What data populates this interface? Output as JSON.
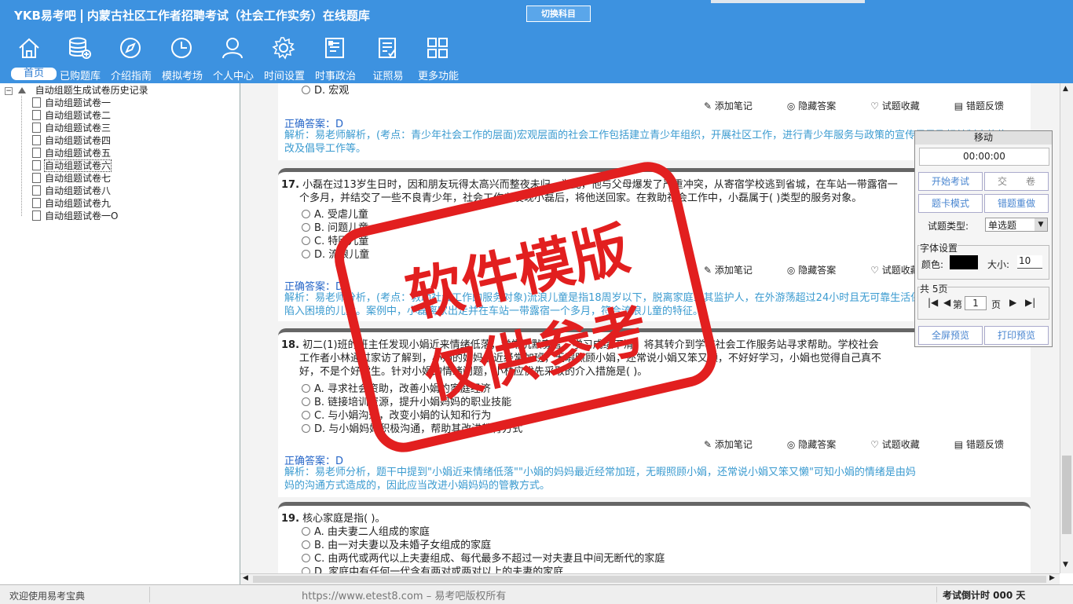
{
  "header": {
    "brand": "YKB易考吧",
    "title": "内蒙古社区工作者招聘考试（社会工作实务）在线题库",
    "switch_label": "切换科目",
    "nav": [
      {
        "label": "首页",
        "icon": "home-icon"
      },
      {
        "label": "已购题库",
        "icon": "database-icon"
      },
      {
        "label": "介绍指南",
        "icon": "compass-icon"
      },
      {
        "label": "模拟考场",
        "icon": "clock-icon"
      },
      {
        "label": "个人中心",
        "icon": "user-icon"
      },
      {
        "label": "时间设置",
        "icon": "gear-icon"
      },
      {
        "label": "时事政治",
        "icon": "news-icon"
      },
      {
        "label": "证照易",
        "icon": "certificate-icon"
      },
      {
        "label": "更多功能",
        "icon": "grid-icon"
      }
    ]
  },
  "tree": {
    "root": "自动组题生成试卷历史记录",
    "items": [
      "自动组题试卷一",
      "自动组题试卷二",
      "自动组题试卷三",
      "自动组题试卷四",
      "自动组题试卷五",
      "自动组题试卷六",
      "自动组题试卷七",
      "自动组题试卷八",
      "自动组题试卷九",
      "自动组题试卷一O"
    ]
  },
  "tools": {
    "note": "添加笔记",
    "hide": "隐藏答案",
    "fav": "试题收藏",
    "report": "错题反馈"
  },
  "prev": {
    "option_d": "D. 宏观",
    "answer": "正确答案：D",
    "analysis": "解析：易老师解析，(考点：青少年社会工作的层面)宏观层面的社会工作包括建立青少年组织，开展社区工作，进行青少年服务与政策的宣传倡导及相关制度的修改及倡导工作等。"
  },
  "questions": [
    {
      "num": "17.",
      "text1": "小磊在过13岁生日时，因和朋友玩得太高兴而整夜未归，为此，他与父母爆发了严重冲突，从寄宿学校逃到省城，在车站一带露宿一",
      "text2": "个多月，并结交了一些不良青少年，社会工作者发现小磊后，将他送回家。在救助社会工作中，小磊属于(  )类型的服务对象。",
      "options": [
        "A. 受虐儿童",
        "B. 问题儿童",
        "C. 特困儿童",
        "D. 流浪儿童"
      ],
      "answer": "正确答案：D",
      "analysis1": "解析：易老师分析，(考点：救助社会工作的服务对象)流浪儿童是指18周岁以下，脱离家庭或其监护人，在外游荡超过24小时且无可靠生活保障，而",
      "analysis2": "陷入困境的儿童。案例中，小磊离家出走并在车站一带露宿一个多月，符合流浪儿童的特征。"
    },
    {
      "num": "18.",
      "text1": "初二(1)班的班主任发现小娟近来情绪低落，常常沉默寡言，学习成绩下滑，将其转介到学校社会工作服务站寻求帮助。学校社会",
      "text2": "工作者小林通过家访了解到，小娟的妈妈最近经常加班，无暇照顾小娟，还常说小娟又笨又懒，不好好学习，小娟也觉得自己真不",
      "text3": "好，不是个好学生。针对小娟的情绪问题，小林应优先采取的介入措施是(  )。",
      "options": [
        "A. 寻求社会资助，改善小娟的家庭经济",
        "B. 链接培训资源，提升小娟妈妈的职业技能",
        "C. 与小娟沟通，改变小娟的认知和行为",
        "D. 与小娟妈妈积极沟通，帮助其改进教育方式"
      ],
      "answer": "正确答案：D",
      "analysis1": "解析：易老师分析，题干中提到\"小娟近来情绪低落\"\"小娟的妈妈最近经常加班，无暇照顾小娟，还常说小娟又笨又懒\"可知小娟的情绪是由妈",
      "analysis2": "妈的沟通方式造成的，因此应当改进小娟妈妈的管教方式。"
    },
    {
      "num": "19.",
      "text1": "核心家庭是指(  )。",
      "options": [
        "A. 由夫妻二人组成的家庭",
        "B. 由一对夫妻以及未婚子女组成的家庭",
        "C. 由两代或两代以上夫妻组成、每代最多不超过一对夫妻且中间无断代的家庭",
        "D. 家庭中有任何一代含有两对或两对以上的夫妻的家庭"
      ]
    }
  ],
  "panel": {
    "title": "移动",
    "timer": "00:00:00",
    "start": "开始考试",
    "submit": "交　　卷",
    "card_mode": "题卡模式",
    "redo_wrong": "错题重做",
    "type_label": "试题类型:",
    "type_value": "单选题",
    "font_group": "字体设置",
    "color_label": "颜色:",
    "size_label": "大小:",
    "size_value": "10",
    "pages_label": "共 5页",
    "page_prefix": "第",
    "page_value": "1",
    "page_suffix": "页",
    "fullscreen": "全屏预览",
    "print": "打印预览"
  },
  "status": {
    "welcome": "欢迎使用易考宝典",
    "copyright": "https://www.etest8.com – 易考吧版权所有",
    "countdown": "考试倒计时 000 天"
  },
  "stamp": {
    "line1": "软件模版",
    "line2": "仅供参考"
  }
}
